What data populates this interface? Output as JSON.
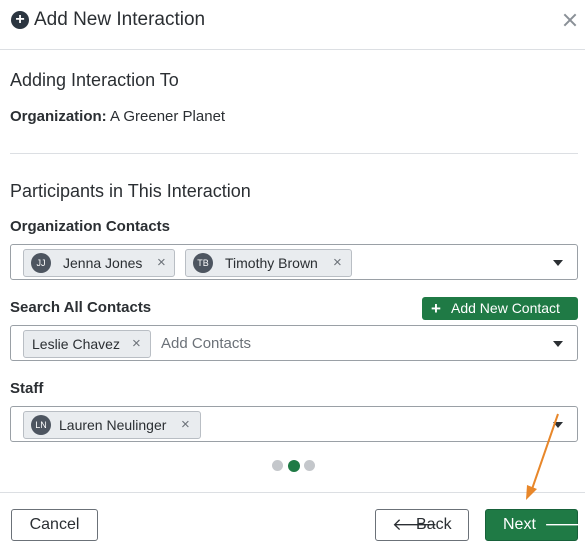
{
  "dialog": {
    "title": "Add New Interaction",
    "header_icon": "plus-circle-icon",
    "close_icon": "close-icon"
  },
  "adding_to": {
    "heading": "Adding Interaction To",
    "org_label": "Organization:",
    "org_name": "A Greener Planet"
  },
  "participants": {
    "heading": "Participants in This Interaction",
    "org_contacts": {
      "label": "Organization Contacts",
      "chips": [
        {
          "initials": "JJ",
          "name": "Jenna Jones",
          "remove": "×"
        },
        {
          "initials": "TB",
          "name": "Timothy Brown",
          "remove": "×"
        }
      ]
    },
    "search_contacts": {
      "label": "Search All Contacts",
      "add_button_icon": "+",
      "add_button_label": "Add New Contact",
      "chips": [
        {
          "name": "Leslie Chavez",
          "remove": "×"
        }
      ],
      "placeholder": "Add Contacts"
    },
    "staff": {
      "label": "Staff",
      "chips": [
        {
          "initials": "LN",
          "name": "Lauren Neulinger",
          "remove": "×"
        }
      ]
    }
  },
  "pager": {
    "steps": 3,
    "current": 2
  },
  "footer": {
    "cancel_label": "Cancel",
    "back_arrow": "🡐",
    "back_label": "Back",
    "next_label": "Next",
    "next_arrow": "🡒"
  },
  "colors": {
    "primary_green": "#1f7a45",
    "annotation_orange": "#e8872a"
  }
}
